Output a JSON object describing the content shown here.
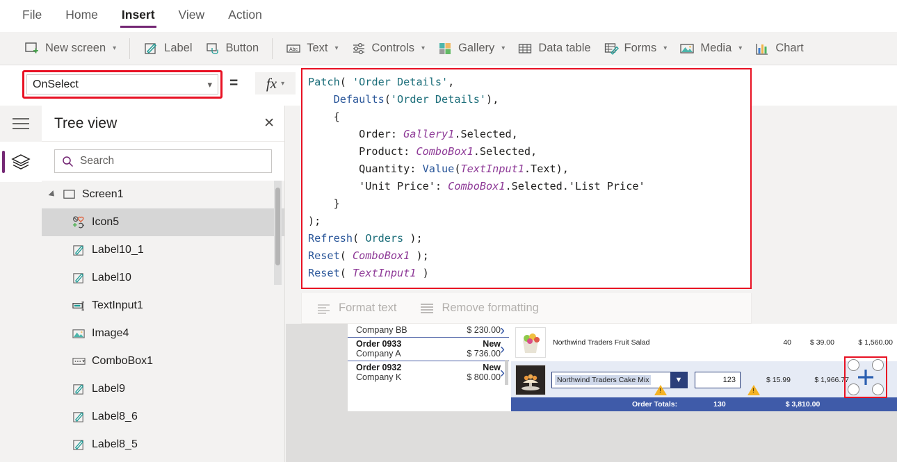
{
  "menu": {
    "items": [
      {
        "label": "File",
        "active": false
      },
      {
        "label": "Home",
        "active": false
      },
      {
        "label": "Insert",
        "active": true
      },
      {
        "label": "View",
        "active": false
      },
      {
        "label": "Action",
        "active": false
      }
    ]
  },
  "ribbon": {
    "items": [
      {
        "label": "New screen",
        "icon": "new-screen-icon",
        "caret": true
      },
      {
        "label": "Label",
        "icon": "label-icon",
        "caret": false
      },
      {
        "label": "Button",
        "icon": "button-icon",
        "caret": false
      },
      {
        "label": "Text",
        "icon": "text-abc-icon",
        "caret": true
      },
      {
        "label": "Controls",
        "icon": "controls-sliders-icon",
        "caret": true
      },
      {
        "label": "Gallery",
        "icon": "gallery-squares-icon",
        "caret": true
      },
      {
        "label": "Data table",
        "icon": "data-table-icon",
        "caret": false
      },
      {
        "label": "Forms",
        "icon": "forms-icon",
        "caret": true
      },
      {
        "label": "Media",
        "icon": "media-image-icon",
        "caret": true
      },
      {
        "label": "Chart",
        "icon": "chart-bars-icon",
        "caret": false
      }
    ]
  },
  "formula_bar": {
    "property": "OnSelect",
    "equals": "=",
    "fx_label": "fx",
    "format_text": "Format text",
    "remove_formatting": "Remove formatting",
    "code_lines": [
      [
        {
          "t": "Patch",
          "c": "fn"
        },
        {
          "t": "( ",
          "c": "pl"
        },
        {
          "t": "'Order Details'",
          "c": "str"
        },
        {
          "t": ",",
          "c": "pl"
        }
      ],
      [
        {
          "t": "    ",
          "c": "pl"
        },
        {
          "t": "Defaults",
          "c": "fn2"
        },
        {
          "t": "(",
          "c": "pl"
        },
        {
          "t": "'Order Details'",
          "c": "str"
        },
        {
          "t": "),",
          "c": "pl"
        }
      ],
      [
        {
          "t": "    {",
          "c": "pl"
        }
      ],
      [
        {
          "t": "        Order: ",
          "c": "pl"
        },
        {
          "t": "Gallery1",
          "c": "ctl"
        },
        {
          "t": ".Selected,",
          "c": "pl"
        }
      ],
      [
        {
          "t": "        Product: ",
          "c": "pl"
        },
        {
          "t": "ComboBox1",
          "c": "ctl"
        },
        {
          "t": ".Selected,",
          "c": "pl"
        }
      ],
      [
        {
          "t": "        Quantity: ",
          "c": "pl"
        },
        {
          "t": "Value",
          "c": "fn2"
        },
        {
          "t": "(",
          "c": "pl"
        },
        {
          "t": "TextInput1",
          "c": "ctl"
        },
        {
          "t": ".Text),",
          "c": "pl"
        }
      ],
      [
        {
          "t": "        'Unit Price': ",
          "c": "pl"
        },
        {
          "t": "ComboBox1",
          "c": "ctl"
        },
        {
          "t": ".Selected.'List Price'",
          "c": "pl"
        }
      ],
      [
        {
          "t": "    }",
          "c": "pl"
        }
      ],
      [
        {
          "t": ");",
          "c": "pl"
        }
      ],
      [
        {
          "t": "Refresh",
          "c": "fn2"
        },
        {
          "t": "( ",
          "c": "pl"
        },
        {
          "t": "Orders",
          "c": "str"
        },
        {
          "t": " );",
          "c": "pl"
        }
      ],
      [
        {
          "t": "Reset",
          "c": "fn2"
        },
        {
          "t": "( ",
          "c": "pl"
        },
        {
          "t": "ComboBox1",
          "c": "ctl"
        },
        {
          "t": " );",
          "c": "pl"
        }
      ],
      [
        {
          "t": "Reset",
          "c": "fn2"
        },
        {
          "t": "( ",
          "c": "pl"
        },
        {
          "t": "TextInput1",
          "c": "ctl"
        },
        {
          "t": " )",
          "c": "pl"
        }
      ]
    ]
  },
  "tree_view": {
    "title": "Tree view",
    "close_label": "✕",
    "search_placeholder": "Search",
    "nodes": [
      {
        "label": "Screen1",
        "icon": "screen-icon",
        "level": 0,
        "expanded": true,
        "selected": false
      },
      {
        "label": "Icon5",
        "icon": "icon-badge-icon",
        "level": 1,
        "selected": true
      },
      {
        "label": "Label10_1",
        "icon": "label-pencil-icon",
        "level": 1,
        "selected": false
      },
      {
        "label": "Label10",
        "icon": "label-pencil-icon",
        "level": 1,
        "selected": false
      },
      {
        "label": "TextInput1",
        "icon": "text-input-icon",
        "level": 1,
        "selected": false
      },
      {
        "label": "Image4",
        "icon": "image-icon",
        "level": 1,
        "selected": false
      },
      {
        "label": "ComboBox1",
        "icon": "combobox-icon",
        "level": 1,
        "selected": false
      },
      {
        "label": "Label9",
        "icon": "label-pencil-icon",
        "level": 1,
        "selected": false
      },
      {
        "label": "Label8_6",
        "icon": "label-pencil-icon",
        "level": 1,
        "selected": false
      },
      {
        "label": "Label8_5",
        "icon": "label-pencil-icon",
        "level": 1,
        "selected": false
      }
    ]
  },
  "canvas": {
    "order_gallery": [
      {
        "order": "",
        "status": "",
        "company": "Company BB",
        "amount": "$ 230.00",
        "partial": true
      },
      {
        "order": "Order 0933",
        "status": "New",
        "company": "Company A",
        "amount": "$ 736.00",
        "partial": false
      },
      {
        "order": "Order 0932",
        "status": "New",
        "company": "Company K",
        "amount": "$ 800.00",
        "partial": false
      }
    ],
    "detail_rows": [
      {
        "product": "Northwind Traders Fruit Salad",
        "qty": "40",
        "price": "$ 39.00",
        "total": "$ 1,560.00",
        "editing": false
      },
      {
        "product": "Northwind Traders Cake Mix",
        "qty": "123",
        "price": "$ 15.99",
        "total": "$ 1,966.77",
        "editing": true
      }
    ],
    "totals": {
      "label": "Order Totals:",
      "qty": "130",
      "amount": "$ 3,810.00"
    }
  },
  "colors": {
    "accent": "#742774",
    "highlight_red": "#e81123",
    "totals_blue": "#3f5ba9",
    "teal": "#1c9c96"
  }
}
